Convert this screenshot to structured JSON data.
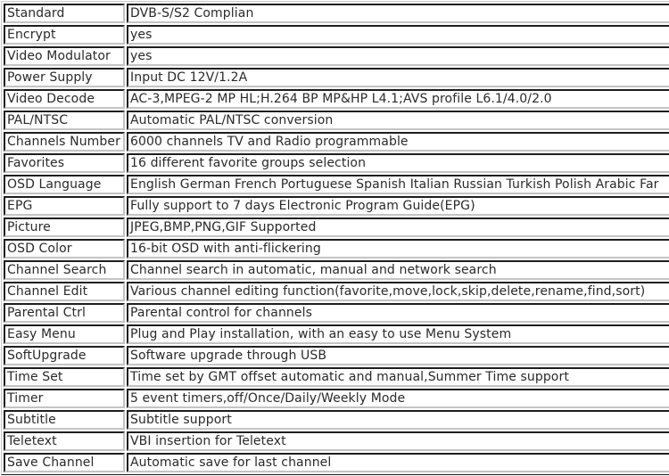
{
  "table": {
    "rows": [
      {
        "label": "Standard",
        "value": "DVB-S/S2 Complian"
      },
      {
        "label": "Encrypt",
        "value": "yes"
      },
      {
        "label": "Video Modulator",
        "value": "yes"
      },
      {
        "label": "Power Supply",
        "value": "Input DC 12V/1.2A"
      },
      {
        "label": "Video Decode",
        "value": "AC-3,MPEG-2 MP HL;H.264 BP MP&HP L4.1;AVS profile L6.1/4.0/2.0"
      },
      {
        "label": "PAL/NTSC",
        "value": "Automatic PAL/NTSC conversion"
      },
      {
        "label": "Channels Number",
        "value": "6000 channels TV and Radio programmable"
      },
      {
        "label": "Favorites",
        "value": "16 different favorite groups selection"
      },
      {
        "label": "OSD Language",
        "value": "English German French Portuguese Spanish Italian Russian Turkish Polish Arabic Far"
      },
      {
        "label": "EPG",
        "value": "Fully support to 7 days Electronic Program Guide(EPG)"
      },
      {
        "label": "Picture",
        "value": "JPEG,BMP,PNG,GIF Supported"
      },
      {
        "label": "OSD Color",
        "value": "16-bit OSD with anti-flickering"
      },
      {
        "label": "Channel Search",
        "value": "Channel search in automatic, manual and network search"
      },
      {
        "label": "Channel Edit",
        "value": "Various channel editing function(favorite,move,lock,skip,delete,rename,find,sort)"
      },
      {
        "label": "Parental Ctrl",
        "value": "Parental control for channels"
      },
      {
        "label": "Easy Menu",
        "value": "Plug and Play installation, with an easy to use Menu System"
      },
      {
        "label": "SoftUpgrade",
        "value": "Software upgrade through USB"
      },
      {
        "label": "Time Set",
        "value": "Time set by GMT offset automatic and manual,Summer Time support"
      },
      {
        "label": "Timer",
        "value": "5 event timers,off/Once/Daily/Weekly Mode"
      },
      {
        "label": "Subtitle",
        "value": "Subtitle support"
      },
      {
        "label": "Teletext",
        "value": "VBI insertion for Teletext"
      },
      {
        "label": "Save Channel",
        "value": "Automatic save for last channel"
      }
    ]
  }
}
